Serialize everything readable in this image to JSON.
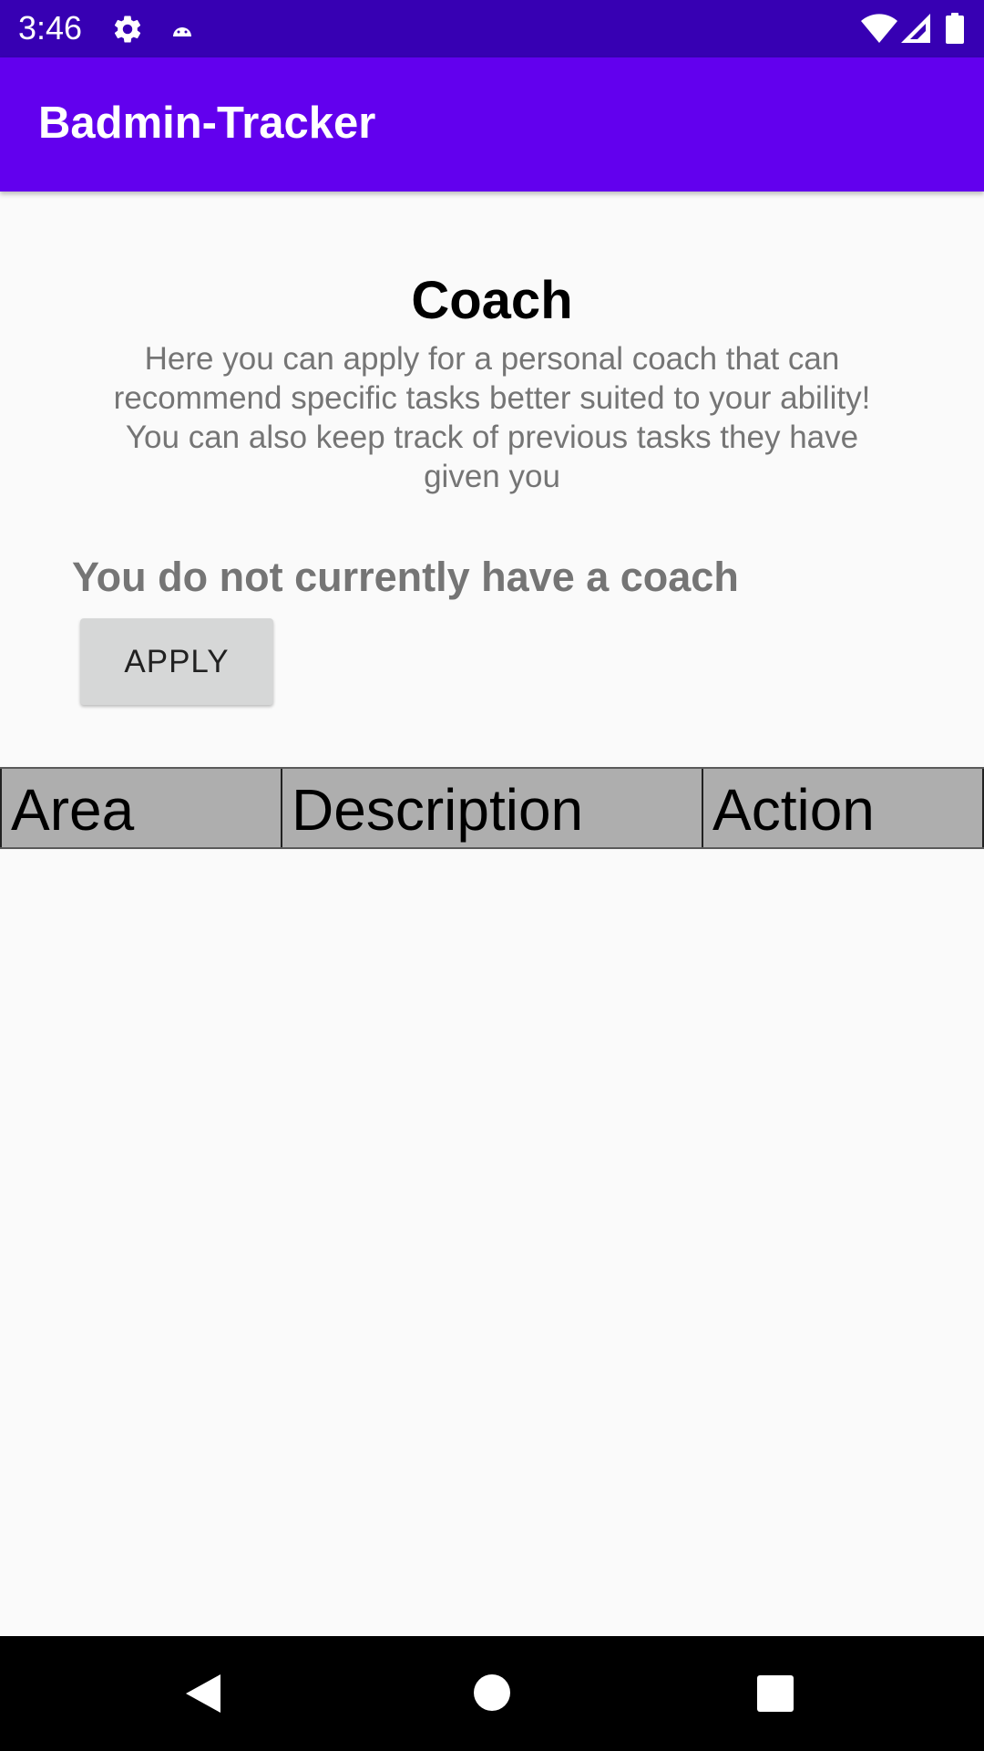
{
  "status_bar": {
    "time": "3:46",
    "icons": [
      "settings-gear-icon",
      "android-notification-icon",
      "wifi-icon",
      "cellular-signal-icon",
      "battery-icon"
    ],
    "background_color": "#3700b3"
  },
  "app_bar": {
    "title": "Badmin-Tracker",
    "background_color": "#6200ee"
  },
  "main": {
    "heading": "Coach",
    "description": "Here you can apply for a personal coach that can recommend specific tasks better suited to your ability! You can also keep track of previous tasks they have given you",
    "coach_status": "You do not currently have a coach",
    "apply_button_label": "APPLY"
  },
  "table": {
    "columns": [
      "Area",
      "Description",
      "Action"
    ],
    "rows": []
  },
  "nav_bar": {
    "buttons": [
      "back-icon",
      "home-icon",
      "recents-icon"
    ]
  }
}
